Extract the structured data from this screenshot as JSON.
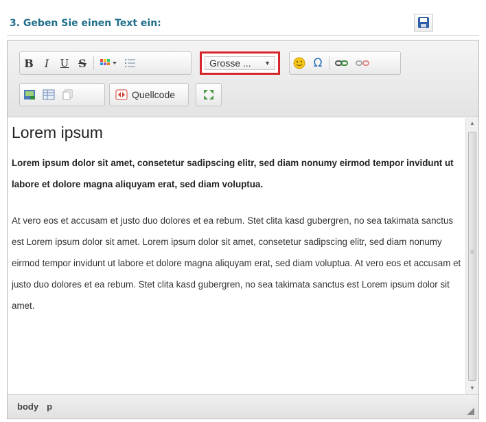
{
  "header": {
    "title": "3. Geben Sie einen Text ein:",
    "save_icon": "floppy-disk-icon"
  },
  "toolbar": {
    "bold": "B",
    "italic": "I",
    "underline": "U",
    "strikethrough": "S",
    "font_size_value": "Grosse ...",
    "special_char": "Ω",
    "source_label": "Quellcode"
  },
  "content": {
    "heading": "Lorem ipsum",
    "bold_paragraph": "Lorem ipsum dolor sit amet, consetetur sadipscing elitr, sed diam nonumy eirmod tempor invidunt ut labore et dolore magna aliquyam erat, sed diam voluptua.",
    "paragraph": "At vero eos et accusam et justo duo dolores et ea rebum. Stet clita kasd gubergren, no sea takimata sanctus est Lorem ipsum dolor sit amet. Lorem ipsum dolor sit amet, consetetur sadipscing elitr, sed diam nonumy eirmod tempor invidunt ut labore et dolore magna aliquyam erat, sed diam voluptua. At vero eos et accusam et justo duo dolores et ea rebum. Stet clita kasd gubergren, no sea takimata sanctus est Lorem ipsum dolor sit amet."
  },
  "statusbar": {
    "path": [
      "body",
      "p"
    ]
  },
  "colors": {
    "accent": "#1f6e8a",
    "highlight_border": "#d6262c"
  }
}
